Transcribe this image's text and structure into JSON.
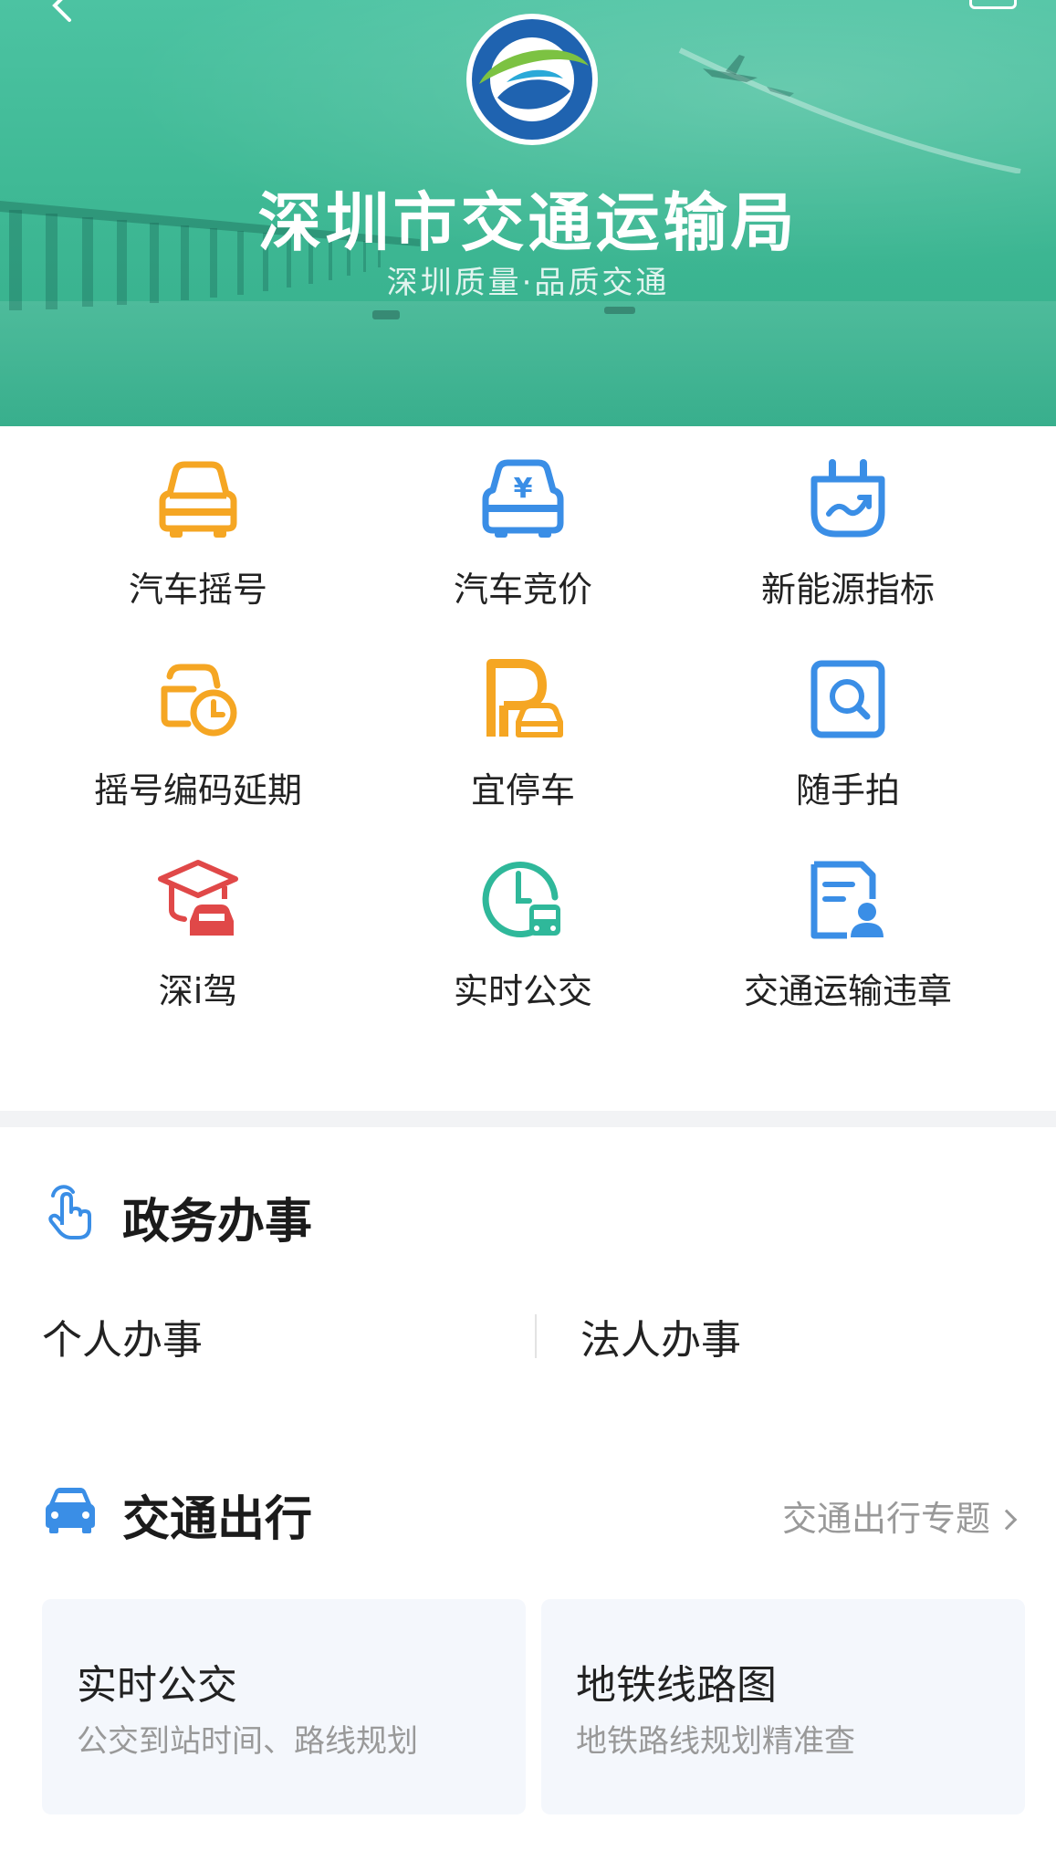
{
  "header": {
    "title": "深圳市交通运输局",
    "subtitle": "深圳质量·品质交通"
  },
  "services": [
    {
      "label": "汽车摇号",
      "icon": "car-icon",
      "color": "#f5a623"
    },
    {
      "label": "汽车竞价",
      "icon": "car-yuan-icon",
      "color": "#3a8ee6"
    },
    {
      "label": "新能源指标",
      "icon": "plug-icon",
      "color": "#3a8ee6"
    },
    {
      "label": "摇号编码延期",
      "icon": "car-clock-icon",
      "color": "#f5a623"
    },
    {
      "label": "宜停车",
      "icon": "parking-icon",
      "color": "#f5a623"
    },
    {
      "label": "随手拍",
      "icon": "search-frame-icon",
      "color": "#3a8ee6"
    },
    {
      "label": "深i驾",
      "icon": "graduation-car-icon",
      "color": "#e04848"
    },
    {
      "label": "实时公交",
      "icon": "clock-bus-icon",
      "color": "#2fb89a"
    },
    {
      "label": "交通运输违章",
      "icon": "document-user-icon",
      "color": "#3a8ee6"
    }
  ],
  "gov": {
    "title": "政务办事",
    "tabs": [
      "个人办事",
      "法人办事"
    ]
  },
  "traffic": {
    "title": "交通出行",
    "more": "交通出行专题",
    "cards": [
      {
        "title": "实时公交",
        "desc": "公交到站时间、路线规划"
      },
      {
        "title": "地铁线路图",
        "desc": "地铁路线规划精准查"
      }
    ]
  }
}
